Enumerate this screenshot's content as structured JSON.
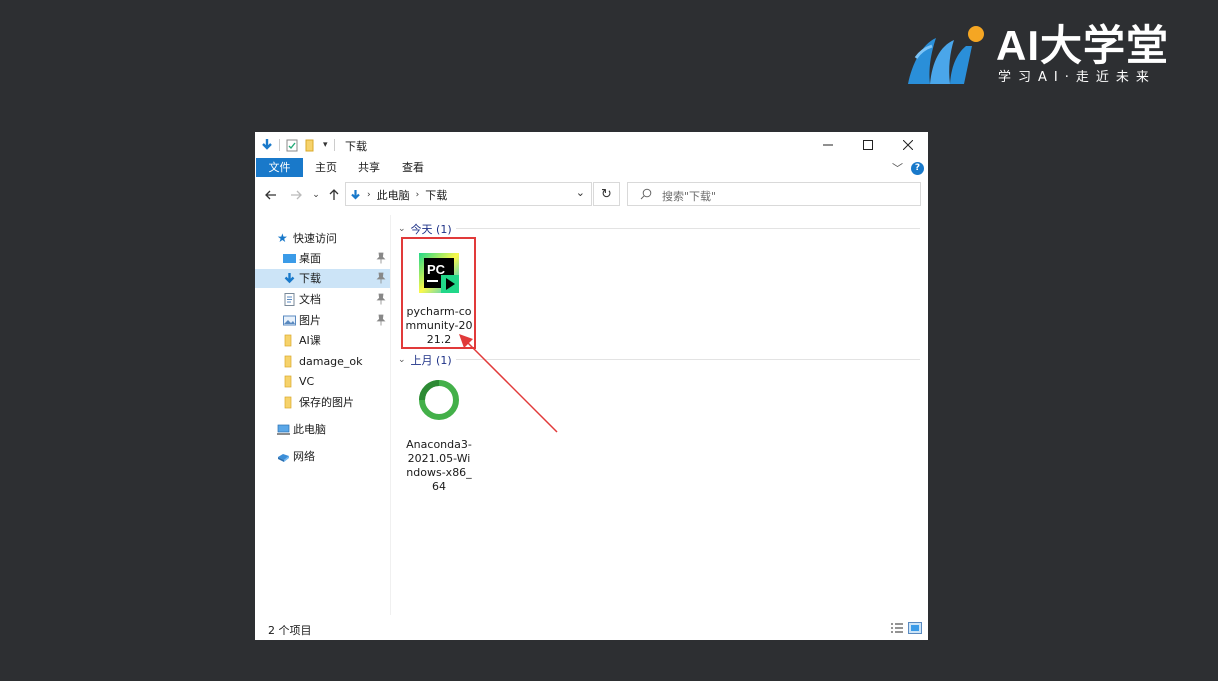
{
  "brand": {
    "title": "AI大学堂",
    "slogan": "学习AI·走近未来",
    "colors": {
      "primary": "#2a8fd9",
      "accent": "#f5a623"
    }
  },
  "window": {
    "title": "下载",
    "ribbon_tabs": [
      "文件",
      "主页",
      "共享",
      "查看"
    ],
    "address_path": [
      "此电脑",
      "下载"
    ],
    "search_placeholder": "搜索\"下载\"",
    "accent_color": "#1979ca"
  },
  "nav": {
    "quick_access": "快速访问",
    "items": [
      {
        "label": "桌面",
        "icon": "desktop-icon",
        "pinned": true
      },
      {
        "label": "下载",
        "icon": "download-icon",
        "pinned": true,
        "selected": true
      },
      {
        "label": "文档",
        "icon": "documents-icon",
        "pinned": true
      },
      {
        "label": "图片",
        "icon": "pictures-icon",
        "pinned": true
      },
      {
        "label": "AI课",
        "icon": "folder-icon"
      },
      {
        "label": "damage_ok",
        "icon": "folder-icon"
      },
      {
        "label": "VC",
        "icon": "folder-icon"
      },
      {
        "label": "保存的图片",
        "icon": "folder-icon"
      }
    ],
    "this_pc": "此电脑",
    "network": "网络"
  },
  "content": {
    "groups": [
      {
        "header": "今天 (1)",
        "files": [
          {
            "name": "pycharm-community-2021.2",
            "icon": "pycharm-icon"
          }
        ]
      },
      {
        "header": "上月 (1)",
        "files": [
          {
            "name": "Anaconda3-2021.05-Windows-x86_64",
            "icon": "anaconda-icon"
          }
        ]
      }
    ],
    "annotation_color": "#e13a3a"
  },
  "status": {
    "count": "2 个项目"
  }
}
